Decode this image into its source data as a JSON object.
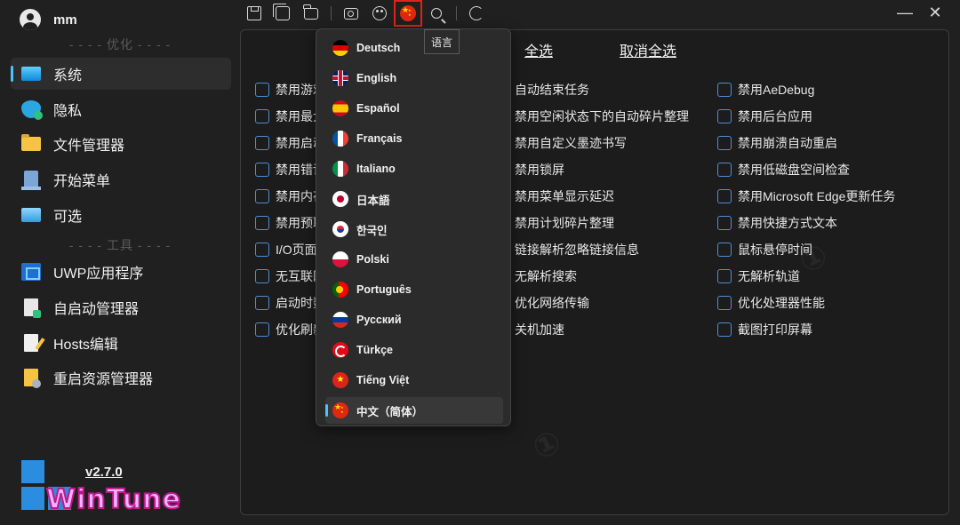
{
  "user": {
    "name": "mm"
  },
  "sidebar": {
    "section_optimize": "- - - - 优化 - - - -",
    "section_tools": "- - - - 工具 - - - -",
    "items": [
      {
        "label": "系统",
        "icon": "system-icon",
        "active": true
      },
      {
        "label": "隐私",
        "icon": "privacy-icon"
      },
      {
        "label": "文件管理器",
        "icon": "folder-icon"
      },
      {
        "label": "开始菜单",
        "icon": "start-menu-icon"
      },
      {
        "label": "可选",
        "icon": "optional-icon"
      }
    ],
    "tools": [
      {
        "label": "UWP应用程序",
        "icon": "uwp-icon"
      },
      {
        "label": "自启动管理器",
        "icon": "startup-icon"
      },
      {
        "label": "Hosts编辑",
        "icon": "hosts-edit-icon"
      },
      {
        "label": "重启资源管理器",
        "icon": "restart-explorer-icon"
      }
    ],
    "version": "v2.7.0",
    "logo_text": "WinTune"
  },
  "toolbar": {
    "language_tooltip": "语言",
    "icons": [
      "save-icon",
      "save-all-icon",
      "open-folder-icon",
      "screenshot-icon",
      "theme-icon",
      "language-flag-icon",
      "search-icon",
      "refresh-icon"
    ]
  },
  "window": {
    "minimize": "—",
    "close": "✕"
  },
  "main": {
    "select_all": "全选",
    "deselect_all": "取消全选",
    "col1": [
      "禁用游戏",
      "禁用最大",
      "禁用启动",
      "禁用错误",
      "禁用内存",
      "禁用预取",
      "I/O页面锁",
      "无互联网",
      "启动时数",
      "优化刷新"
    ],
    "col2": [
      "自动结束任务",
      "禁用空闲状态下的自动碎片整理",
      "禁用自定义墨迹书写",
      "禁用锁屏",
      "禁用菜单显示延迟",
      "禁用计划碎片整理",
      "链接解析忽略链接信息",
      "无解析搜索",
      "优化网络传输",
      "关机加速"
    ],
    "col3": [
      "禁用AeDebug",
      "禁用后台应用",
      "禁用崩溃自动重启",
      "禁用低磁盘空间检查",
      "禁用Microsoft Edge更新任务",
      "禁用快捷方式文本",
      "鼠标悬停时间",
      "无解析轨道",
      "优化处理器性能",
      "截图打印屏幕"
    ]
  },
  "languages": [
    {
      "label": "Deutsch",
      "flag": "de"
    },
    {
      "label": "English",
      "flag": "en"
    },
    {
      "label": "Español",
      "flag": "es"
    },
    {
      "label": "Français",
      "flag": "fr"
    },
    {
      "label": "Italiano",
      "flag": "it"
    },
    {
      "label": "日本語",
      "flag": "jp"
    },
    {
      "label": "한국인",
      "flag": "kr"
    },
    {
      "label": "Polski",
      "flag": "pl"
    },
    {
      "label": "Português",
      "flag": "pt"
    },
    {
      "label": "Русский",
      "flag": "ru"
    },
    {
      "label": "Türkçe",
      "flag": "tr"
    },
    {
      "label": "Tiếng Việt",
      "flag": "vn"
    },
    {
      "label": "中文（简体）",
      "flag": "cn",
      "selected": true
    }
  ]
}
